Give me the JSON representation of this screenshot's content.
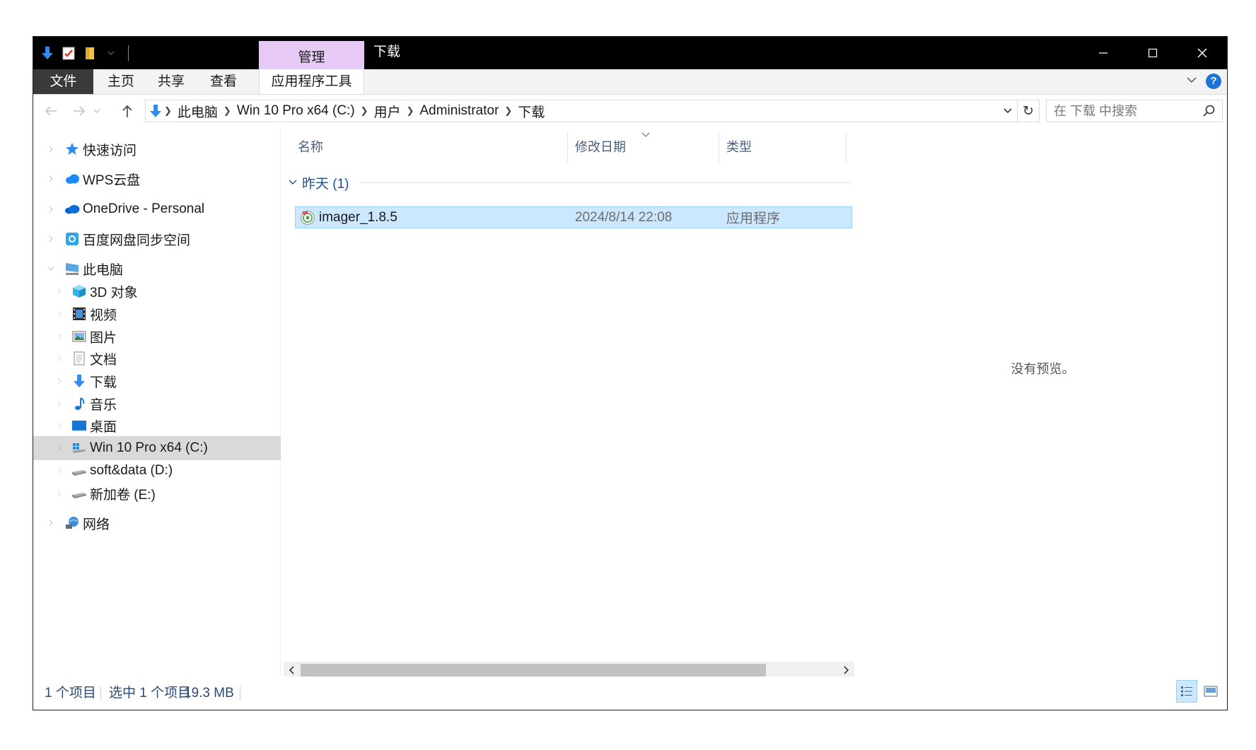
{
  "window": {
    "title": "下载",
    "contextual_tab": "管理"
  },
  "ribbon": {
    "tabs": [
      {
        "label": "文件"
      },
      {
        "label": "主页"
      },
      {
        "label": "共享"
      },
      {
        "label": "查看"
      },
      {
        "label": "应用程序工具"
      }
    ]
  },
  "address": {
    "crumbs": [
      "此电脑",
      "Win 10 Pro x64 (C:)",
      "用户",
      "Administrator",
      "下载"
    ]
  },
  "search": {
    "placeholder": "在 下载 中搜索"
  },
  "navigation": {
    "items": [
      {
        "label": "快速访问",
        "icon": "star-icon"
      },
      {
        "label": "WPS云盘",
        "icon": "cloud-icon"
      },
      {
        "label": "OneDrive - Personal",
        "icon": "onedrive-icon"
      },
      {
        "label": "百度网盘同步空间",
        "icon": "baidu-icon"
      },
      {
        "label": "此电脑",
        "icon": "computer-icon"
      },
      {
        "label": "3D 对象",
        "icon": "3d-objects-icon"
      },
      {
        "label": "视频",
        "icon": "video-icon"
      },
      {
        "label": "图片",
        "icon": "pictures-icon"
      },
      {
        "label": "文档",
        "icon": "documents-icon"
      },
      {
        "label": "下载",
        "icon": "downloads-icon"
      },
      {
        "label": "音乐",
        "icon": "music-icon"
      },
      {
        "label": "桌面",
        "icon": "desktop-icon"
      },
      {
        "label": "Win 10 Pro x64 (C:)",
        "icon": "system-drive-icon"
      },
      {
        "label": "soft&data (D:)",
        "icon": "drive-icon"
      },
      {
        "label": "新加卷 (E:)",
        "icon": "drive-icon"
      },
      {
        "label": "网络",
        "icon": "network-icon"
      }
    ]
  },
  "filelist": {
    "columns": [
      "名称",
      "修改日期",
      "类型"
    ],
    "group": "昨天 (1)",
    "files": [
      {
        "name": "imager_1.8.5",
        "date": "2024/8/14 22:08",
        "type": "应用程序",
        "icon": "installer-icon"
      }
    ]
  },
  "preview": {
    "message": "没有预览。"
  },
  "status": {
    "count": "1 个项目",
    "selection": "选中 1 个项目",
    "size": "19.3 MB"
  },
  "colors": {
    "accent": "#1e73d8",
    "selection_bg": "#cce8ff",
    "selection_border": "#99d1ff",
    "contextual_tab": "#e6c9f5"
  }
}
